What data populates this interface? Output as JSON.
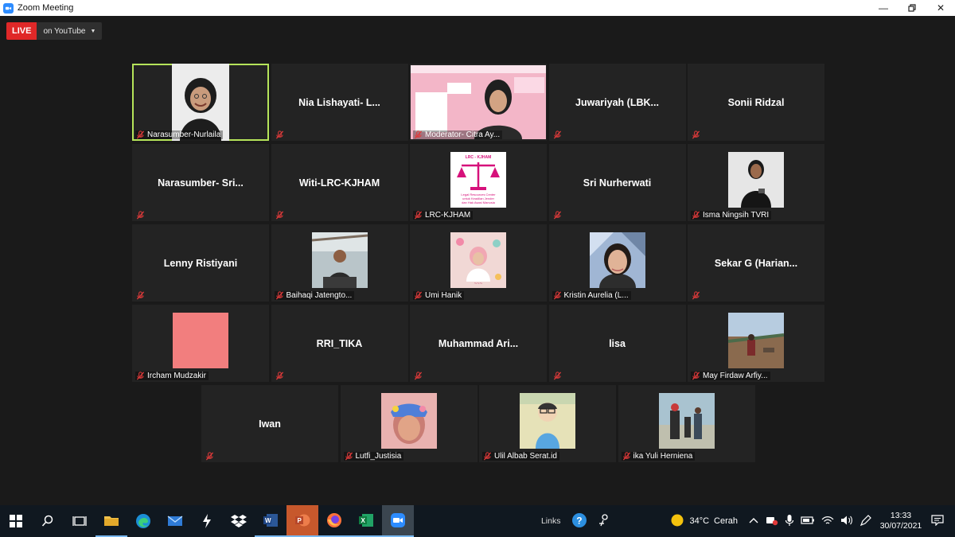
{
  "window": {
    "title": "Zoom Meeting"
  },
  "live": {
    "badge": "LIVE",
    "destination": "on YouTube"
  },
  "participants": [
    {
      "name": "Narasumber-Nurlaila",
      "video": "person-hijab",
      "active": true
    },
    {
      "name": "Nia Lishayati- L...",
      "video": null
    },
    {
      "name": "Moderator- Citra Ay...",
      "video": "slide-person"
    },
    {
      "name": "Juwariyah (LBK...",
      "video": null
    },
    {
      "name": "Sonii Ridzal",
      "video": null
    },
    {
      "name": "Narasumber- Sri...",
      "video": null
    },
    {
      "name": "Witi-LRC-KJHAM",
      "video": null
    },
    {
      "name": "LRC-KJHAM",
      "video": "logo-scale"
    },
    {
      "name": "Sri Nurherwati",
      "video": null
    },
    {
      "name": "Isma Ningsih TVRI",
      "video": "photo-reporter"
    },
    {
      "name": "Lenny Ristiyani",
      "video": null
    },
    {
      "name": "Baihaqi Jatengto...",
      "video": "photo-man"
    },
    {
      "name": "Umi Hanik",
      "video": "photo-poster"
    },
    {
      "name": "Kristin Aurelia (L...",
      "video": "photo-woman"
    },
    {
      "name": "Sekar G (Harian...",
      "video": null
    },
    {
      "name": "Ircham Mudzakir",
      "video": "salmon-square"
    },
    {
      "name": "RRI_TIKA",
      "video": null
    },
    {
      "name": "Muhammad Ari...",
      "video": null
    },
    {
      "name": "lisa",
      "video": null
    },
    {
      "name": "May Firdaw Arfiy...",
      "video": "photo-outdoor"
    },
    {
      "name": "Iwan",
      "video": null
    },
    {
      "name": "Lutfi_Justisia",
      "video": "photo-child"
    },
    {
      "name": "Ulil Albab Serat.id",
      "video": "cartoon"
    },
    {
      "name": "ika Yuli Herniena",
      "video": "photo-group"
    }
  ],
  "logo_text": {
    "line1": "LRC - KJHAM",
    "line2": "Legal Resources Center",
    "line3": "untuk Keadilan Jender",
    "line4": "dan Hak Asasi Manusia"
  },
  "taskbar": {
    "links_label": "Links",
    "weather": {
      "temp": "34°C",
      "condition": "Cerah"
    },
    "time": "13:33",
    "date": "30/07/2021"
  },
  "colors": {
    "live_red": "#e02828",
    "active_speaker_border": "#b5e45a",
    "tile_bg": "#232323",
    "muted_icon": "#e23a3a"
  }
}
